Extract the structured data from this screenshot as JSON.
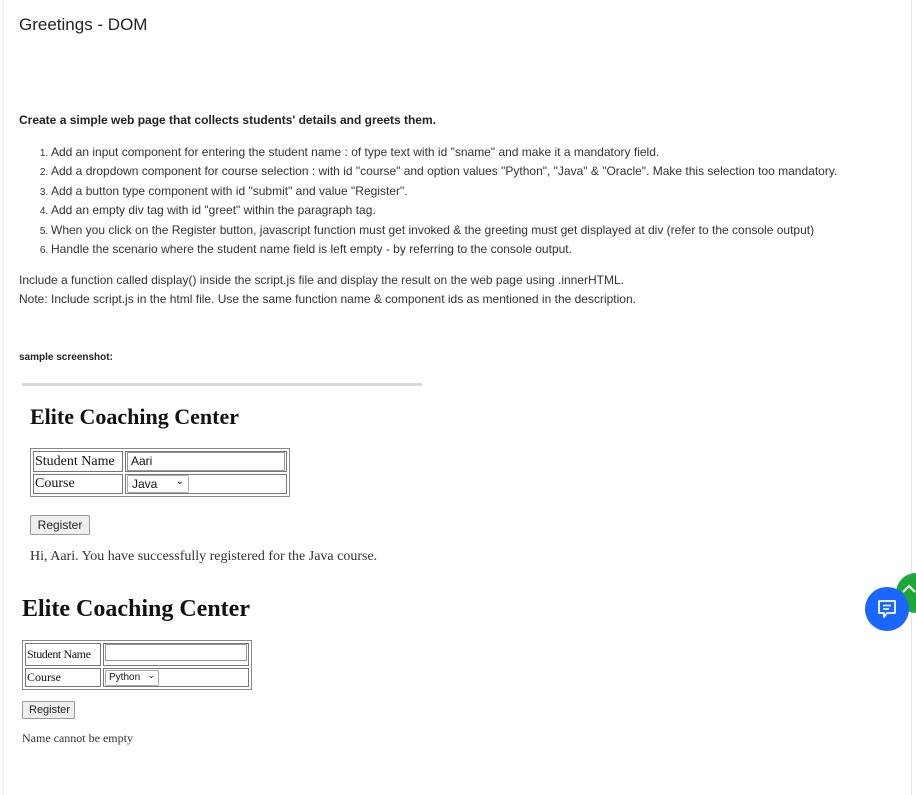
{
  "title": "Greetings - DOM",
  "heading": "Create a simple web page that collects students' details and greets them.",
  "steps": [
    "Add an input component for entering the student name : of type text with id \"sname\" and make it a mandatory field.",
    "Add a  dropdown component for course selection :  with id \"course\" and option values \"Python\", \"Java\" & \"Oracle\". Make this selection too mandatory.",
    "Add a button type component with id \"submit\" and value \"Register\".",
    "Add an empty div tag with id \"greet\" within the paragraph tag.",
    "When you click on the Register button, javascript function must get invoked & the greeting must get displayed at div (refer to the console output)",
    "Handle the scenario where the student name field is left empty - by referring to the console output."
  ],
  "para": [
    "Include a function called display() inside the script.js file and display the result on the web page using .innerHTML.",
    "Note: Include script.js in the html file. Use the same function name & component ids as mentioned in the description."
  ],
  "sample_label": "sample screenshot:",
  "sample1": {
    "heading": "Elite Coaching Center",
    "name_label": "Student Name",
    "name_value": "Aari",
    "course_label": "Course",
    "course_value": "Java",
    "button": "Register",
    "result": "Hi, Aari. You have successfully registered for the Java course."
  },
  "sample2": {
    "heading": "Elite Coaching Center",
    "name_label": "Student Name",
    "name_value": "",
    "course_label": "Course",
    "course_value": "Python",
    "button": "Register",
    "result": "Name cannot be empty"
  },
  "colors": {
    "chat": "#1a66ff",
    "scroll_top": "#1fa83a"
  }
}
